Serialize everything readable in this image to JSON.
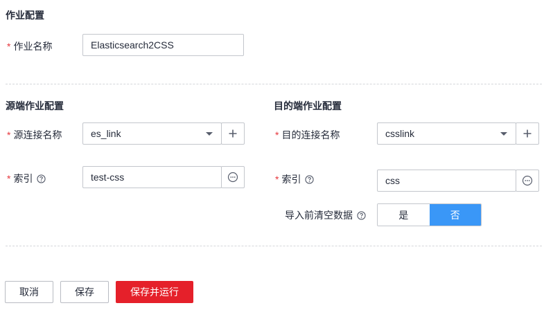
{
  "job_config": {
    "title": "作业配置",
    "name_label": "作业名称",
    "name_value": "Elasticsearch2CSS"
  },
  "source": {
    "title": "源端作业配置",
    "link_label": "源连接名称",
    "link_value": "es_link",
    "index_label": "索引",
    "index_value": "test-css"
  },
  "destination": {
    "title": "目的端作业配置",
    "link_label": "目的连接名称",
    "link_value": "csslink",
    "index_label": "索引",
    "index_value": "css",
    "clear_label": "导入前清空数据",
    "clear_options": [
      "是",
      "否"
    ],
    "clear_selected": "否"
  },
  "footer": {
    "cancel_label": "取消",
    "save_label": "保存",
    "save_run_label": "保存并运行"
  },
  "required_marker": "*",
  "colors": {
    "required": "#e6363c",
    "segment_active": "#3a97f7",
    "primary_button": "#e5202a"
  }
}
